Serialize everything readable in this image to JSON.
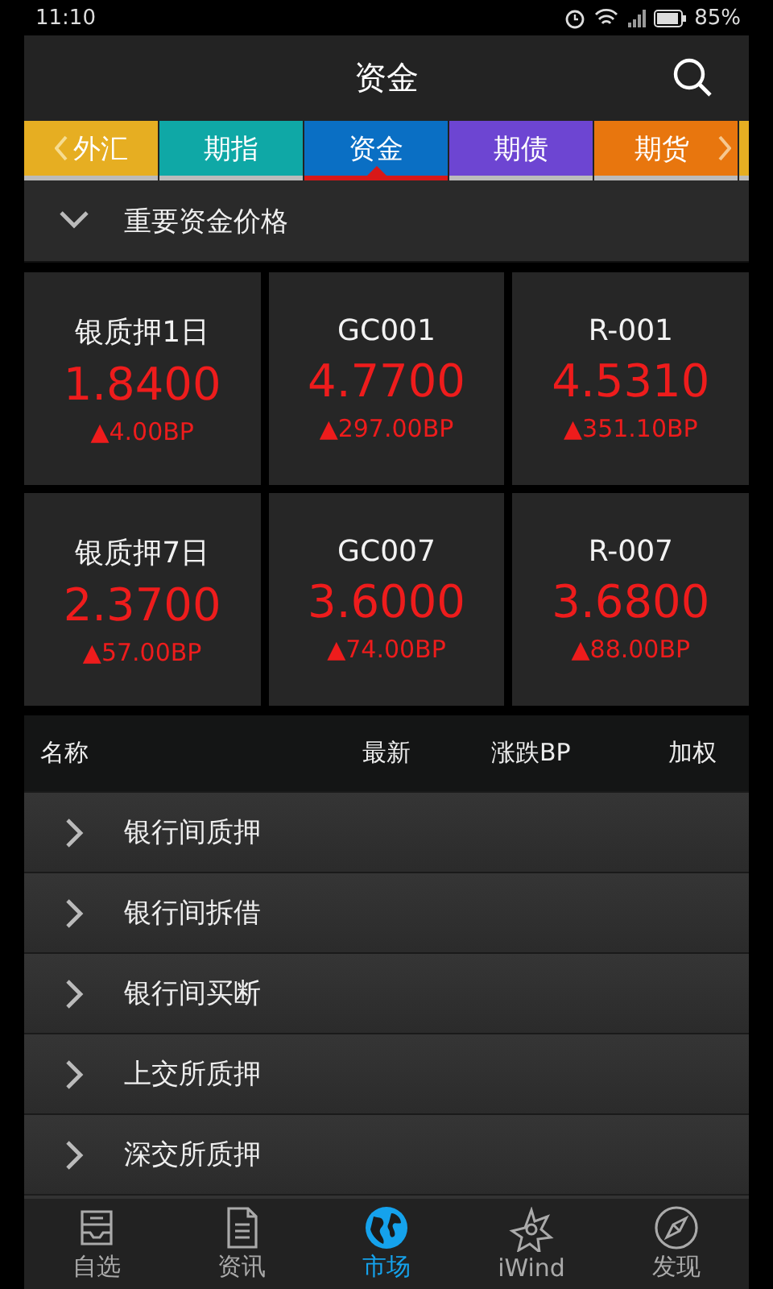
{
  "status_bar": {
    "time": "11:10",
    "battery": "85%"
  },
  "header": {
    "title": "资金"
  },
  "tabs": [
    {
      "label": "外汇",
      "color": "#e6ae22",
      "selected": false
    },
    {
      "label": "期指",
      "color": "#0fa8a6",
      "selected": false
    },
    {
      "label": "资金",
      "color": "#0a6fc4",
      "selected": true
    },
    {
      "label": "期债",
      "color": "#6d45d2",
      "selected": false
    },
    {
      "label": "期货",
      "color": "#e8760e",
      "selected": false
    }
  ],
  "section": {
    "title": "重要资金价格",
    "expanded": true
  },
  "cards": [
    {
      "name": "银质押1日",
      "value": "1.8400",
      "change": "▲4.00BP"
    },
    {
      "name": "GC001",
      "value": "4.7700",
      "change": "▲297.00BP"
    },
    {
      "name": "R-001",
      "value": "4.5310",
      "change": "▲351.10BP"
    },
    {
      "name": "银质押7日",
      "value": "2.3700",
      "change": "▲57.00BP"
    },
    {
      "name": "GC007",
      "value": "3.6000",
      "change": "▲74.00BP"
    },
    {
      "name": "R-007",
      "value": "3.6800",
      "change": "▲88.00BP"
    }
  ],
  "table": {
    "columns": [
      "名称",
      "最新",
      "涨跌BP",
      "加权"
    ],
    "rows": [
      {
        "label": "银行间质押",
        "expanded": false
      },
      {
        "label": "银行间拆借",
        "expanded": false
      },
      {
        "label": "银行间买断",
        "expanded": false
      },
      {
        "label": "上交所质押",
        "expanded": false
      },
      {
        "label": "深交所质押",
        "expanded": false
      }
    ]
  },
  "bottom_nav": [
    {
      "label": "自选",
      "selected": false
    },
    {
      "label": "资讯",
      "selected": false
    },
    {
      "label": "市场",
      "selected": true
    },
    {
      "label": "iWind",
      "selected": false
    },
    {
      "label": "发现",
      "selected": false
    }
  ]
}
